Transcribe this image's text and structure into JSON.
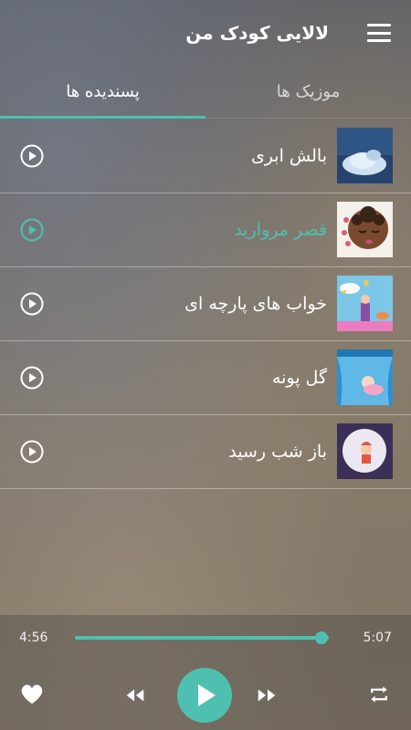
{
  "app": {
    "title": "لالایی کودک من"
  },
  "tabs": [
    {
      "label": "موزیک ها",
      "active": false
    },
    {
      "label": "پسندیده ها",
      "active": true
    }
  ],
  "songs": [
    {
      "title": "بالش ابری",
      "playing": false
    },
    {
      "title": "قصر مروارید",
      "playing": true
    },
    {
      "title": "خواب های پارچه ای",
      "playing": false
    },
    {
      "title": "گل پونه",
      "playing": false
    },
    {
      "title": "باز شب رسید",
      "playing": false
    }
  ],
  "player": {
    "elapsed": "4:56",
    "total": "5:07",
    "progress": 0.97
  },
  "colors": {
    "accent": "#4fc0b0"
  },
  "icons": [
    "menu-icon",
    "play-circle-icon",
    "heart-icon",
    "rewind-icon",
    "play-icon",
    "fast-forward-icon",
    "repeat-icon"
  ]
}
